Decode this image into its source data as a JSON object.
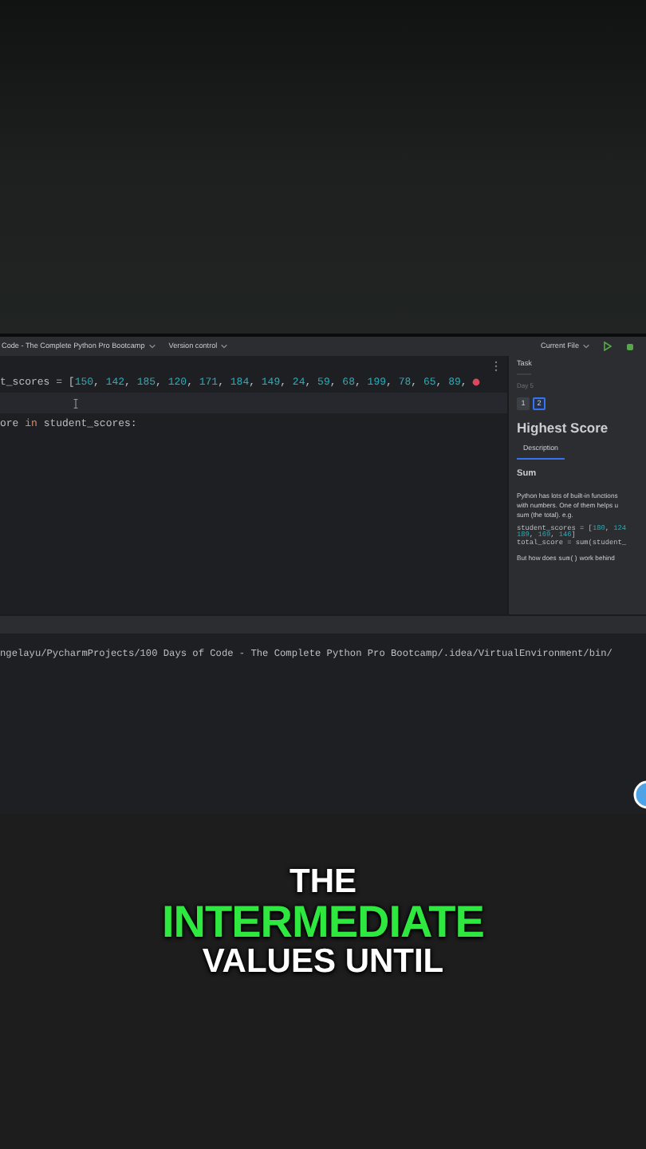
{
  "toolbar": {
    "project": "Code - The Complete Python Pro Bootcamp",
    "vcs": "Version control",
    "run_config": "Current File"
  },
  "editor": {
    "lines": [
      {
        "current": false,
        "error": true,
        "tokens": [
          {
            "t": "t_scores = [",
            "kind": "plain"
          },
          {
            "t": "150",
            "kind": "number"
          },
          {
            "t": ", ",
            "kind": "plain"
          },
          {
            "t": "142",
            "kind": "number"
          },
          {
            "t": ", ",
            "kind": "plain"
          },
          {
            "t": "185",
            "kind": "number"
          },
          {
            "t": ", ",
            "kind": "plain"
          },
          {
            "t": "120",
            "kind": "number"
          },
          {
            "t": ", ",
            "kind": "plain"
          },
          {
            "t": "171",
            "kind": "number"
          },
          {
            "t": ", ",
            "kind": "plain"
          },
          {
            "t": "184",
            "kind": "number"
          },
          {
            "t": ", ",
            "kind": "plain"
          },
          {
            "t": "149",
            "kind": "number"
          },
          {
            "t": ", ",
            "kind": "plain"
          },
          {
            "t": "24",
            "kind": "number"
          },
          {
            "t": ", ",
            "kind": "plain"
          },
          {
            "t": "59",
            "kind": "number"
          },
          {
            "t": ", ",
            "kind": "plain"
          },
          {
            "t": "68",
            "kind": "number"
          },
          {
            "t": ", ",
            "kind": "plain"
          },
          {
            "t": "199",
            "kind": "number"
          },
          {
            "t": ", ",
            "kind": "plain"
          },
          {
            "t": "78",
            "kind": "number"
          },
          {
            "t": ", ",
            "kind": "plain"
          },
          {
            "t": "65",
            "kind": "number"
          },
          {
            "t": ", ",
            "kind": "plain"
          },
          {
            "t": "89",
            "kind": "number"
          },
          {
            "t": ",",
            "kind": "plain"
          }
        ]
      },
      {
        "current": true,
        "error": false
      },
      {
        "current": false,
        "error": false,
        "tokens": [
          {
            "t": "ore ",
            "kind": "plain"
          },
          {
            "t": "in",
            "kind": "keyword"
          },
          {
            "t": " student_scores:",
            "kind": "plain"
          }
        ]
      }
    ]
  },
  "task_panel": {
    "tab": "Task",
    "day": "Day 5",
    "steps": [
      {
        "label": "1",
        "selected": false
      },
      {
        "label": "2",
        "selected": true
      }
    ],
    "title": "Highest Score",
    "section_tab": "Description",
    "heading": "Sum",
    "paragraph": [
      "Python has lots of built-in functions",
      "with numbers. One of them helps u",
      "sum (the total). e.g."
    ],
    "code": [
      [
        {
          "t": "student_scores = [",
          "kind": "plain"
        },
        {
          "t": "180",
          "kind": "number"
        },
        {
          "t": ", ",
          "kind": "plain"
        },
        {
          "t": "124",
          "kind": "number"
        }
      ],
      [
        {
          "t": "189",
          "kind": "number"
        },
        {
          "t": ", ",
          "kind": "plain"
        },
        {
          "t": "169",
          "kind": "number"
        },
        {
          "t": ", ",
          "kind": "plain"
        },
        {
          "t": "146",
          "kind": "number"
        },
        {
          "t": "]",
          "kind": "plain"
        }
      ],
      [
        {
          "t": "total_score = sum(student_",
          "kind": "plain"
        }
      ]
    ],
    "footer": [
      {
        "t": "But how does ",
        "kind": "text"
      },
      {
        "t": "sum()",
        "kind": "code"
      },
      {
        "t": " work behind",
        "kind": "text"
      }
    ]
  },
  "terminal": {
    "path": "ngelayu/PycharmProjects/100 Days of Code - The Complete Python Pro Bootcamp/.idea/VirtualEnvironment/bin/"
  },
  "caption": [
    {
      "text": "THE",
      "highlight": false
    },
    {
      "text": "INTERMEDIATE",
      "highlight": true
    },
    {
      "text": "VALUES UNTIL",
      "highlight": false
    }
  ]
}
